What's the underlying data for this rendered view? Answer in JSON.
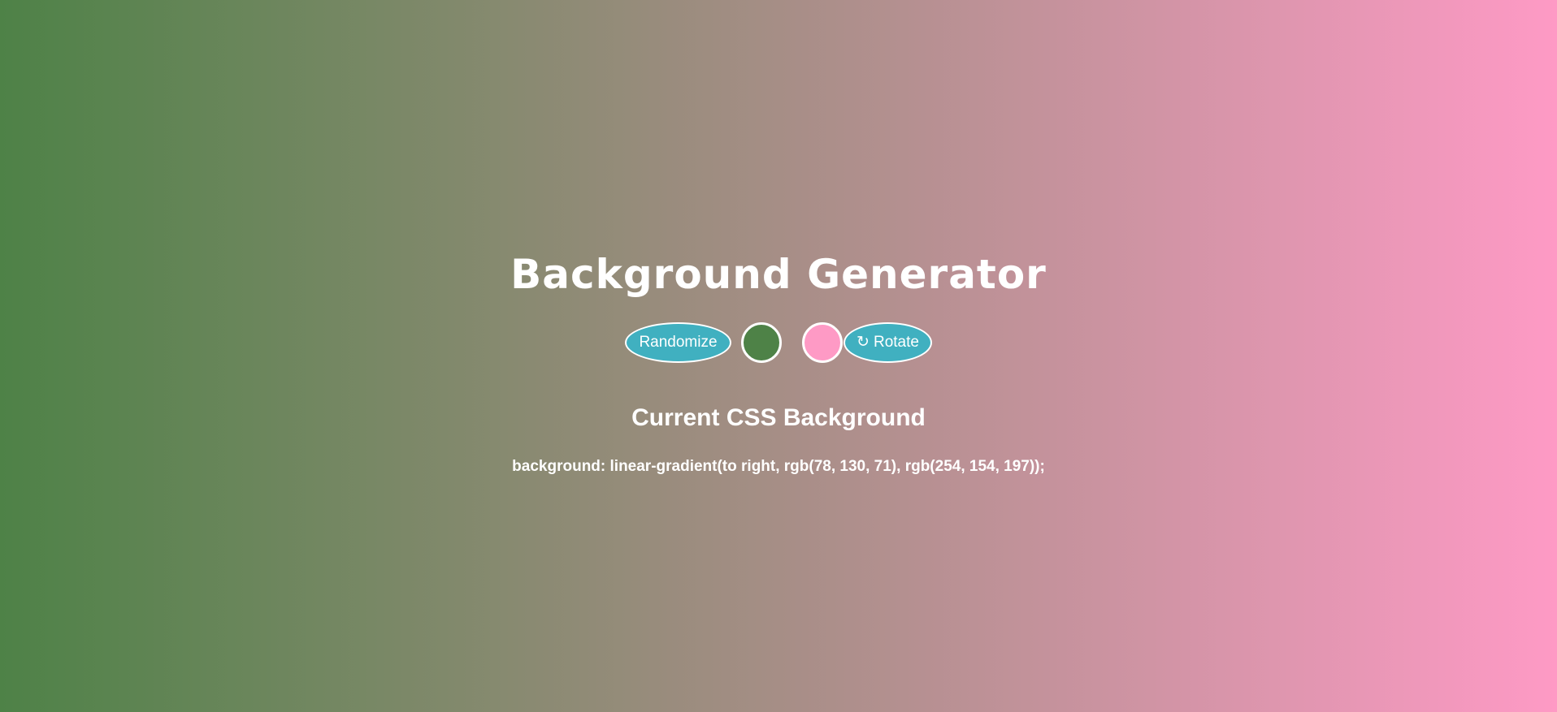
{
  "app": {
    "title": "Background Generator"
  },
  "background": {
    "direction": "to right",
    "color1": "#4e8247",
    "color2": "#fe9ac5"
  },
  "controls": {
    "randomize_label": "Randomize",
    "rotate_icon": "rotate-icon",
    "rotate_glyph": "↻",
    "rotate_label": "Rotate",
    "button_color": "#40b0c0"
  },
  "output": {
    "heading": "Current CSS Background",
    "css_text": "background: linear-gradient(to right, rgb(78, 130, 71), rgb(254, 154, 197));"
  }
}
